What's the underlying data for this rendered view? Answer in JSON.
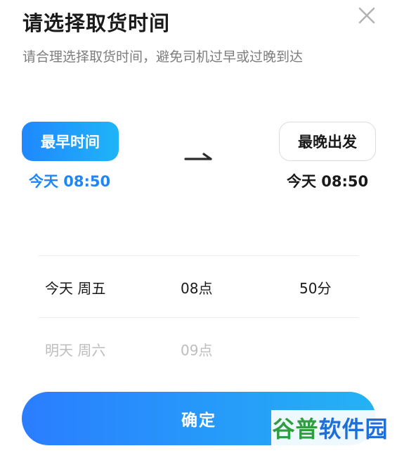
{
  "header": {
    "title": "请选择取货时间",
    "subtitle": "请合理选择取货时间，避免司机过早或过晚到达",
    "close_icon": "close-icon"
  },
  "range": {
    "earliest": {
      "label": "最早时间",
      "time": "今天 08:50",
      "selected": true
    },
    "latest": {
      "label": "最晚出发",
      "time": "今天 08:50",
      "selected": false
    },
    "arrow_icon": "arrow-right-icon"
  },
  "picker": {
    "day": {
      "selected": "今天 周五",
      "next": "明天 周六"
    },
    "hour": {
      "selected": "08点",
      "next": "09点"
    },
    "minute": {
      "selected": "50分"
    }
  },
  "footer": {
    "confirm_label": "确定"
  },
  "watermark": {
    "part1": "谷普",
    "part2": "软件园"
  },
  "colors": {
    "accent": "#1e86f7",
    "gradient_start": "#2a7dff",
    "gradient_end": "#23b3f5"
  }
}
